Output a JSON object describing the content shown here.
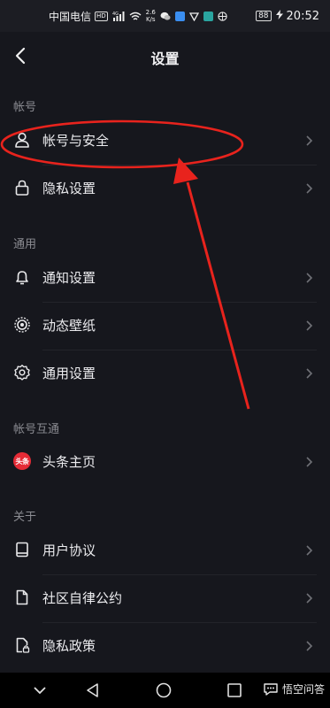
{
  "status_bar": {
    "carrier": "中国电信",
    "hd": "HD",
    "network_type": "4G",
    "speed_value": "2.6",
    "speed_unit": "K/s",
    "battery": "88",
    "time": "20:52"
  },
  "header": {
    "title": "设置"
  },
  "sections": [
    {
      "title": "帐号",
      "items": [
        {
          "label": "帐号与安全",
          "icon": "user-icon"
        },
        {
          "label": "隐私设置",
          "icon": "lock-icon"
        }
      ]
    },
    {
      "title": "通用",
      "items": [
        {
          "label": "通知设置",
          "icon": "bell-icon"
        },
        {
          "label": "动态壁纸",
          "icon": "dynamic-wallpaper-icon"
        },
        {
          "label": "通用设置",
          "icon": "gear-icon"
        }
      ]
    },
    {
      "title": "帐号互通",
      "items": [
        {
          "label": "头条主页",
          "icon": "toutiao-logo",
          "logo_text": "头条"
        }
      ]
    },
    {
      "title": "关于",
      "items": [
        {
          "label": "用户协议",
          "icon": "book-icon"
        },
        {
          "label": "社区自律公约",
          "icon": "document-icon"
        },
        {
          "label": "隐私政策",
          "icon": "privacy-document-icon"
        }
      ]
    }
  ],
  "watermark": {
    "text": "悟空问答"
  },
  "colors": {
    "background": "#16171d",
    "annotation": "#e8231d",
    "section_label": "#8b8c92"
  }
}
